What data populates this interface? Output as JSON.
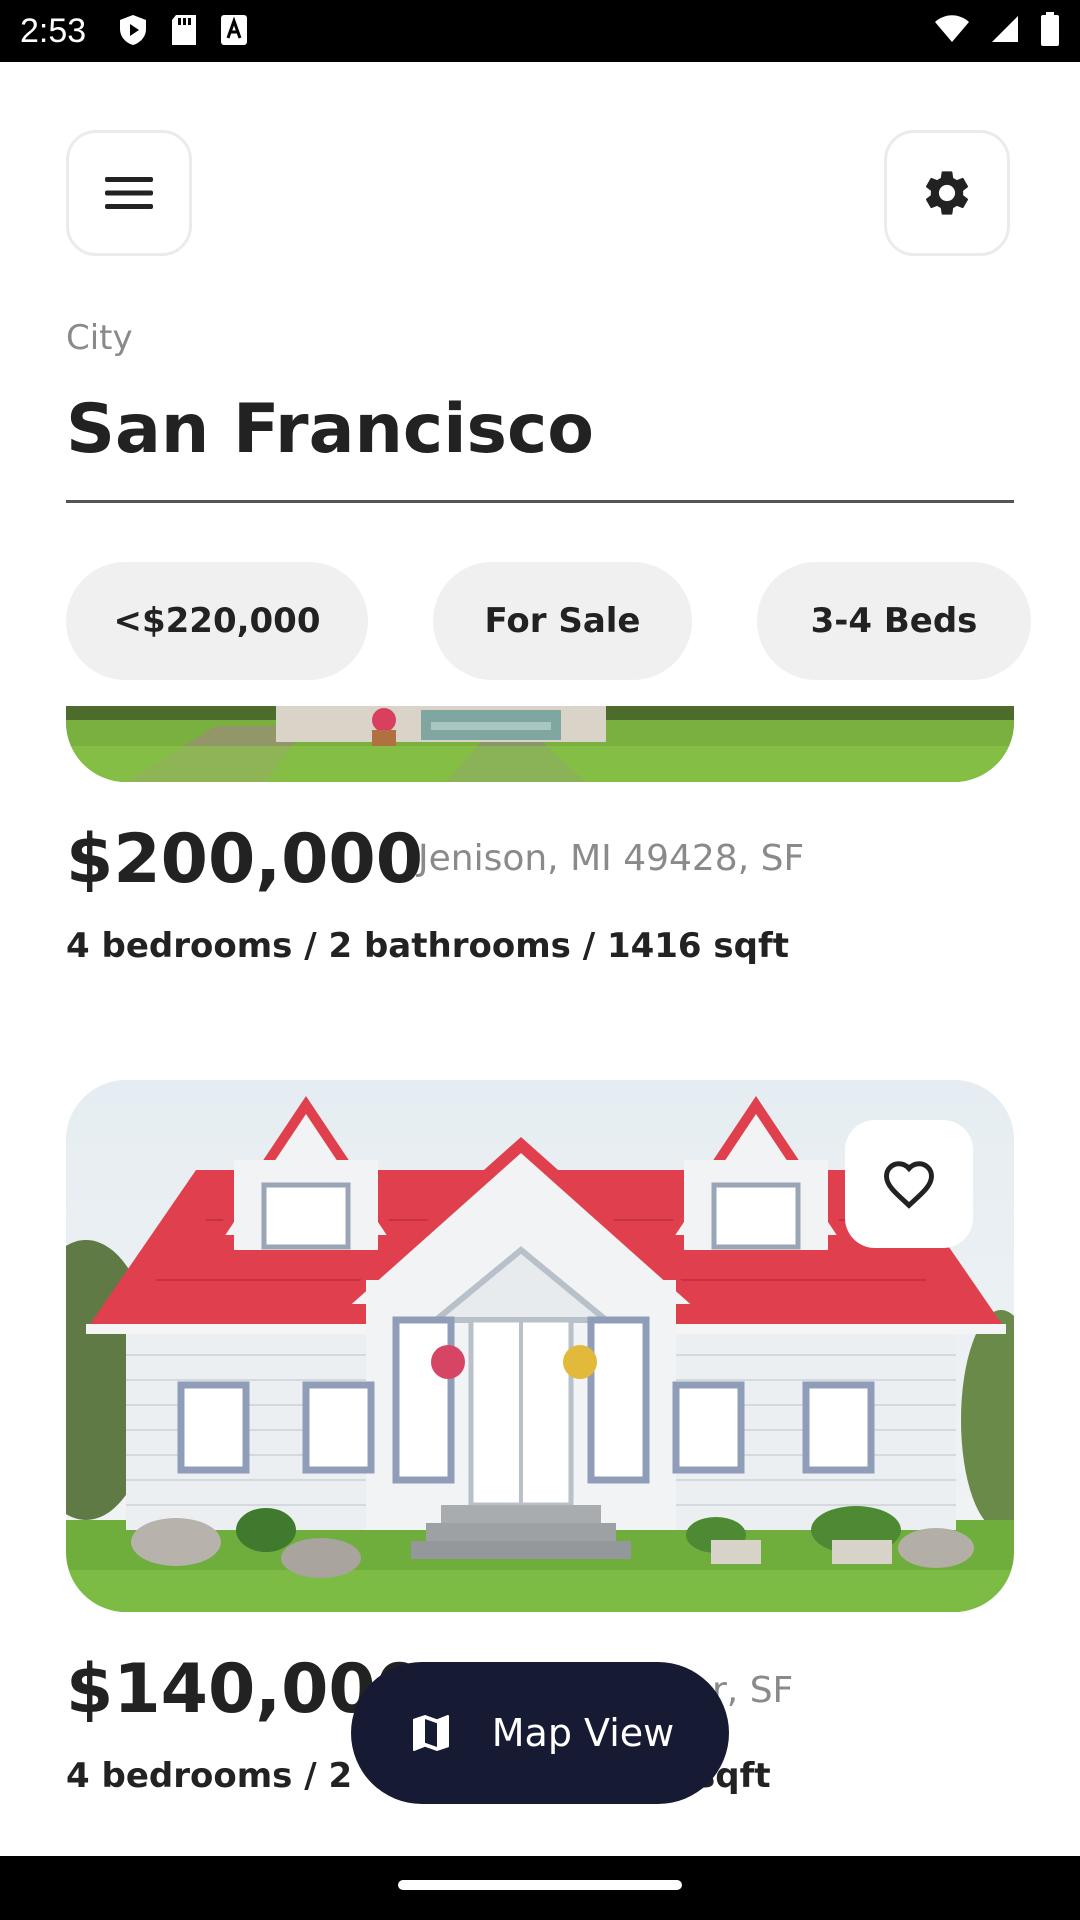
{
  "status_bar": {
    "time": "2:53",
    "left_icons": [
      "play-protect-icon",
      "sd-card-icon",
      "text-a-icon"
    ],
    "right_icons": [
      "wifi-icon",
      "signal-icon",
      "battery-icon"
    ]
  },
  "header": {
    "menu_icon": "hamburger-menu-icon",
    "settings_icon": "gear-icon"
  },
  "search": {
    "label": "City",
    "value": "San Francisco"
  },
  "filters": [
    {
      "label": "<$220,000"
    },
    {
      "label": "For Sale"
    },
    {
      "label": "3-4 Beds"
    }
  ],
  "listings": [
    {
      "price": "$200,000",
      "address": "Jenison, MI 49428, SF",
      "details": "4 bedrooms / 2 bathrooms / 1416 sqft"
    },
    {
      "price": "$140,000",
      "address": "r, SF",
      "details_left": "4 bedrooms / 2 ",
      "details_right": "sqft",
      "favorite_icon": "heart-outline-icon"
    }
  ],
  "map_button": {
    "label": "Map View",
    "icon": "map-icon"
  },
  "colors": {
    "accent_dark": "#171a33",
    "chip_bg": "#f0f0f0",
    "muted_text": "#8a8a8a",
    "roof_red": "#e0404e"
  }
}
